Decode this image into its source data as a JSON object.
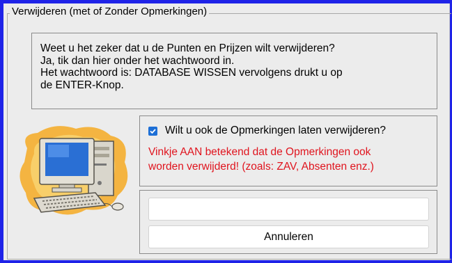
{
  "window": {
    "group_title": "Verwijderen (met of Zonder Opmerkingen)"
  },
  "info": {
    "lines": [
      "Weet u het zeker dat u de Punten en Prijzen wilt verwijderen?",
      "Ja, tik dan hier onder het wachtwoord in.",
      "Het wachtwoord is: DATABASE WISSEN vervolgens drukt u op",
      "de ENTER-Knop."
    ]
  },
  "options": {
    "checkbox_label": "Wilt u ook de Opmerkingen laten verwijderen?",
    "checkbox_checked": true,
    "warning_lines": [
      "Vinkje AAN betekend dat de Opmerkingen ook",
      "worden verwijderd! (zoals: ZAV, Absenten enz.)"
    ]
  },
  "password": {
    "value": ""
  },
  "buttons": {
    "cancel_label": "Annuleren"
  },
  "icon": {
    "name": "computer-icon"
  },
  "colors": {
    "window_border": "#1f23e8",
    "warning_text": "#e0141e",
    "checkbox_accent": "#1d6fd6"
  }
}
